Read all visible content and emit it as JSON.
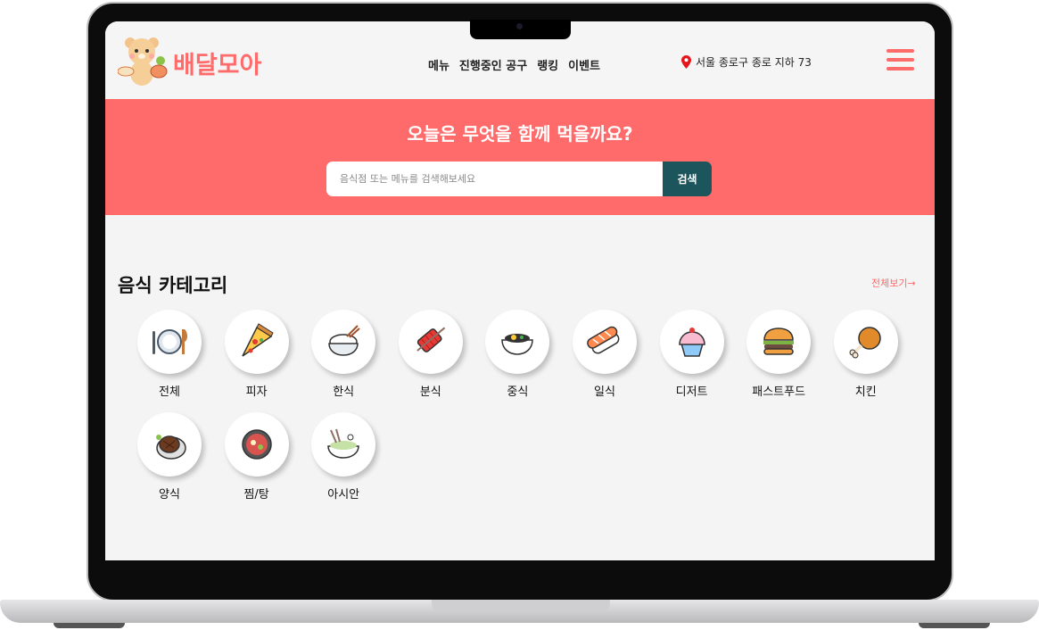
{
  "header": {
    "brand": "배달모아",
    "nav": [
      "메뉴",
      "진행중인 공구",
      "랭킹",
      "이벤트"
    ],
    "location": "서울 종로구 종로 지하 73"
  },
  "hero": {
    "title": "오늘은 무엇을 함께 먹을까요?",
    "search_placeholder": "음식점 또는 메뉴를 검색해보세요",
    "search_button": "검색"
  },
  "categories": {
    "title": "음식 카테고리",
    "see_all": "전체보기→",
    "items": [
      {
        "label": "전체",
        "icon": "utensils-icon"
      },
      {
        "label": "피자",
        "icon": "pizza-icon"
      },
      {
        "label": "한식",
        "icon": "rice-bowl-icon"
      },
      {
        "label": "분식",
        "icon": "tteokbokki-icon"
      },
      {
        "label": "중식",
        "icon": "noodle-bowl-icon"
      },
      {
        "label": "일식",
        "icon": "sushi-icon"
      },
      {
        "label": "디저트",
        "icon": "cupcake-icon"
      },
      {
        "label": "패스트푸드",
        "icon": "burger-icon"
      },
      {
        "label": "치킨",
        "icon": "chicken-leg-icon"
      },
      {
        "label": "양식",
        "icon": "steak-icon"
      },
      {
        "label": "찜/탕",
        "icon": "hot-pot-icon"
      },
      {
        "label": "아시안",
        "icon": "asian-noodle-icon"
      }
    ]
  },
  "colors": {
    "accent": "#ff6b6b",
    "button": "#1d555d"
  }
}
